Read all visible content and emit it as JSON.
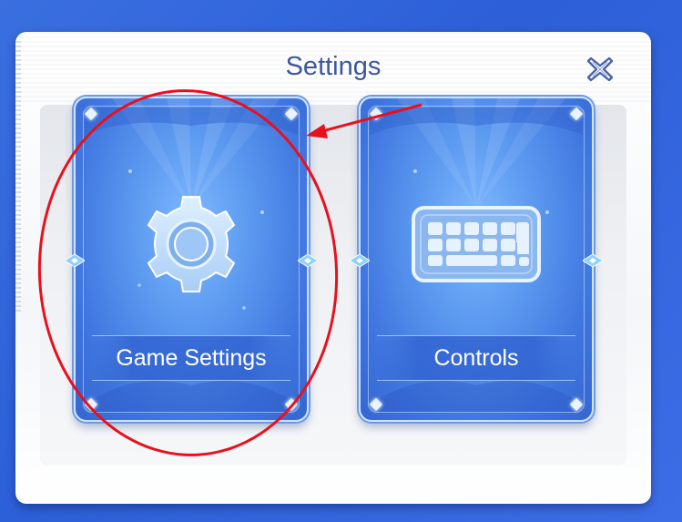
{
  "dialog": {
    "title": "Settings"
  },
  "cards": [
    {
      "label": "Game Settings",
      "icon": "gear-icon"
    },
    {
      "label": "Controls",
      "icon": "keyboard-icon"
    }
  ],
  "annotation": {
    "color": "#e8101c"
  }
}
